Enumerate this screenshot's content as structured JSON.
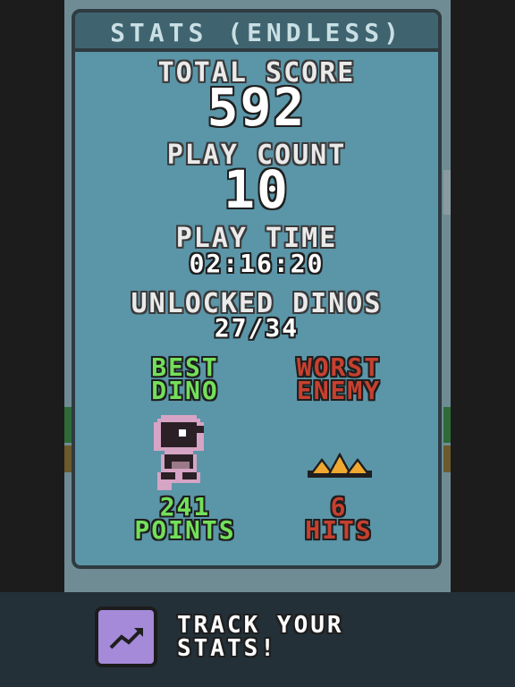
{
  "panel": {
    "title": "STATS (ENDLESS)"
  },
  "stats": {
    "total_score_label": "TOTAL SCORE",
    "total_score_value": "592",
    "play_count_label": "PLAY COUNT",
    "play_count_value": "10",
    "play_time_label": "PLAY TIME",
    "play_time_value": "02:16:20",
    "unlocked_label": "UNLOCKED DINOS",
    "unlocked_value": "27/34"
  },
  "best_dino": {
    "label_line1": "BEST",
    "label_line2": "DINO",
    "icon": "dino-sprite-icon",
    "value_line1": "241",
    "value_line2": "POINTS"
  },
  "worst_enemy": {
    "label_line1": "WORST",
    "label_line2": "ENEMY",
    "icon": "spike-enemy-icon",
    "value_line1": "6",
    "value_line2": "HITS"
  },
  "footer": {
    "button_icon": "trend-up-icon",
    "line1": "TRACK YOUR",
    "line2": "STATS!"
  },
  "colors": {
    "panel": "#5b95a8",
    "header": "#3f6470",
    "best": "#74e05a",
    "worst": "#c8402f",
    "button": "#a48ad8"
  }
}
